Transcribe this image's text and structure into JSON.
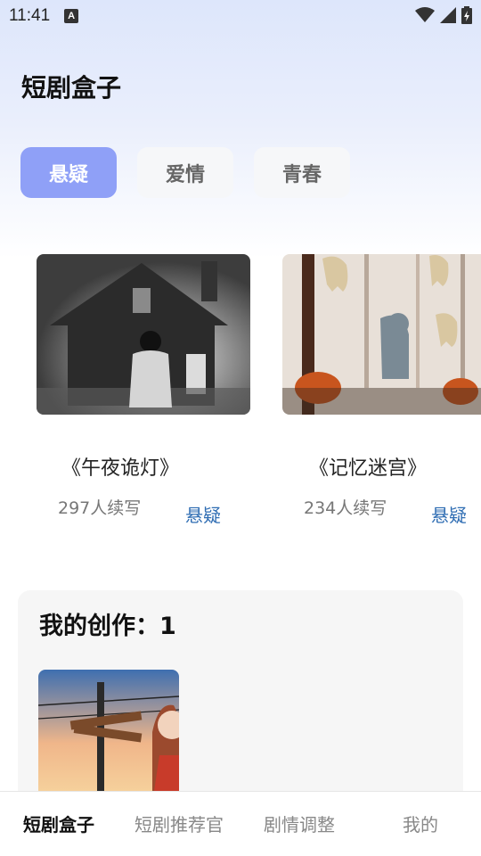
{
  "status_bar": {
    "time": "11:41",
    "notification_icon": "A"
  },
  "app": {
    "title": "短剧盒子"
  },
  "tabs": [
    {
      "label": "悬疑",
      "active": true
    },
    {
      "label": "爱情",
      "active": false
    },
    {
      "label": "青春",
      "active": false
    }
  ],
  "dramas": [
    {
      "title": "《午夜诡灯》",
      "readers": "297人续写",
      "tag": "悬疑",
      "image_icon": "haunted-house-image"
    },
    {
      "title": "《记忆迷宫》",
      "readers": "234人续写",
      "tag": "悬疑",
      "image_icon": "ghost-mouse-pumpkin-image"
    }
  ],
  "my_creations": {
    "title": "我的创作：1",
    "thumbnail_icon": "anime-girl-railway-image"
  },
  "bottom_nav": [
    {
      "label": "短剧盒子",
      "active": true
    },
    {
      "label": "短剧推荐官",
      "active": false
    },
    {
      "label": "剧情调整",
      "active": false
    },
    {
      "label": "我的",
      "active": false
    }
  ],
  "colors": {
    "accent": "#8fa0f7",
    "tag_blue": "#2f6db3",
    "tab_inactive_bg": "#f6f7f9"
  }
}
